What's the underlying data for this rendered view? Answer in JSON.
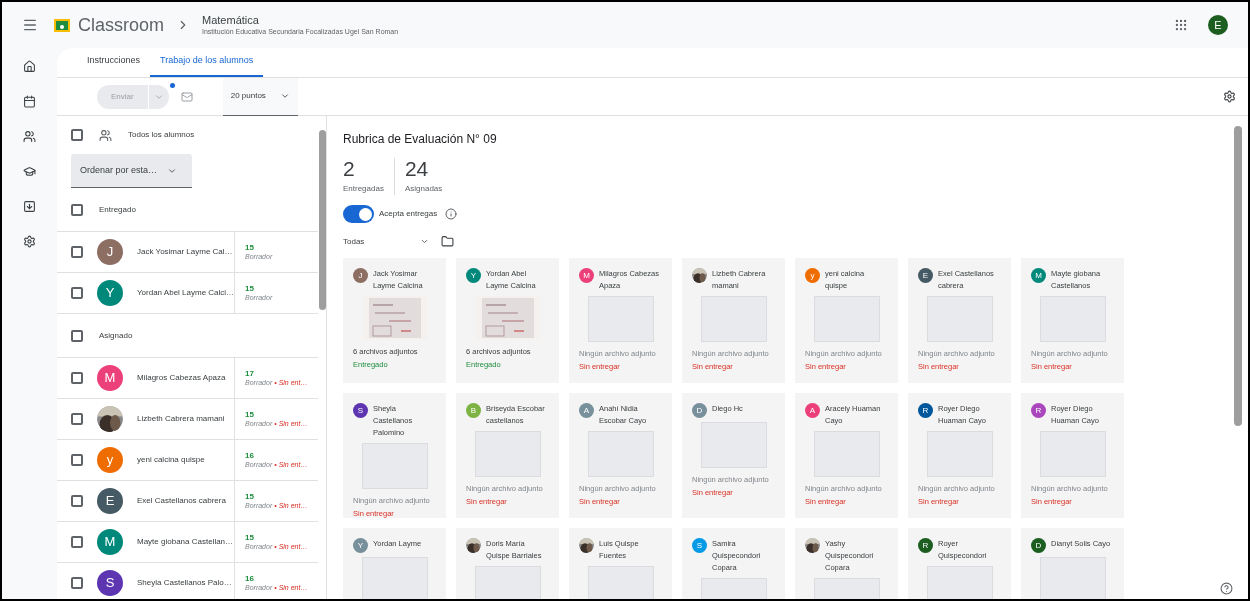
{
  "header": {
    "app_name": "Classroom",
    "class_title": "Matemática",
    "class_subtitle": "Institución Educativa Secundaria Focalizadas Ugel San Roman",
    "account_letter": "E"
  },
  "tabs": [
    {
      "label": "Instrucciones",
      "selected": false
    },
    {
      "label": "Trabajo de los alumnos",
      "selected": true
    }
  ],
  "toolbar": {
    "return_button": "Enviar",
    "points": "20 puntos"
  },
  "student_list": {
    "all_students": {
      "label": "Todos los alumnos",
      "checked": false
    },
    "sort": "Ordenar por esta…",
    "sections": [
      {
        "title": "Entregado",
        "checked": false,
        "students": [
          {
            "name": "Jack Yosimar Layme Cal…",
            "avatar": {
              "kind": "letter",
              "letter": "J",
              "color": "#8d6e63"
            },
            "grade": "15",
            "draft": "Borrador",
            "checked": false
          },
          {
            "name": "Yordan Abel Layme Calci…",
            "avatar": {
              "kind": "letter",
              "letter": "Y",
              "color": "#00897b"
            },
            "grade": "15",
            "draft": "Borrador",
            "checked": false
          }
        ]
      },
      {
        "title": "Asignado",
        "checked": false,
        "students": [
          {
            "name": "Milagros Cabezas Apaza",
            "avatar": {
              "kind": "letter",
              "letter": "M",
              "color": "#ec407a"
            },
            "grade": "17",
            "draft": "Borrador",
            "missing": "• Sin ent…",
            "checked": false
          },
          {
            "name": "Lizbeth Cabrera mamani",
            "grade": "15",
            "draft": "Borrador",
            "missing": "• Sin ent…",
            "checked": false
          },
          {
            "name": "yeni calcina quispe",
            "avatar": {
              "kind": "letter",
              "letter": "y",
              "color": "#ef6c00"
            },
            "grade": "16",
            "draft": "Borrador",
            "missing": "• Sin ent…",
            "checked": false
          },
          {
            "name": "Exel Castellanos cabrera",
            "avatar": {
              "kind": "letter",
              "letter": "E",
              "color": "#455a64"
            },
            "grade": "15",
            "draft": "Borrador",
            "missing": "• Sin ent…",
            "checked": false
          },
          {
            "name": "Mayte giobana Castellan…",
            "avatar": {
              "kind": "letter",
              "letter": "M",
              "color": "#00897b"
            },
            "grade": "15",
            "draft": "Borrador",
            "missing": "• Sin ent…",
            "checked": false
          },
          {
            "name": "Sheyla Castellanos Palo…",
            "avatar": {
              "kind": "letter",
              "letter": "S",
              "color": "#5e35b1"
            },
            "grade": "16",
            "draft": "Borrador",
            "missing": "• Sin ent…",
            "checked": false
          }
        ]
      }
    ]
  },
  "assignment": {
    "title": "Rubrica de Evaluación N° 09",
    "stats": [
      {
        "value": "2",
        "label": "Entregadas"
      },
      {
        "value": "24",
        "label": "Asignadas"
      }
    ],
    "accepting": {
      "label": "Acepta entregas",
      "on": true
    },
    "filter": "Todas",
    "cards": [
      {
        "name": "Jack Yosimar Layme Calcina",
        "avatar": {
          "kind": "letter",
          "letter": "J",
          "color": "#8d6e63"
        },
        "attachments": "6 archivos adjuntos",
        "status": {
          "text": "Entregado",
          "kind": "turned_in"
        }
      },
      {
        "name": "Yordan Abel Layme Calcina",
        "avatar": {
          "kind": "letter",
          "letter": "Y",
          "color": "#00897b"
        },
        "attachments": "6 archivos adjuntos",
        "status": {
          "text": "Entregado",
          "kind": "turned_in"
        }
      },
      {
        "name": "Milagros Cabezas Apaza",
        "avatar": {
          "kind": "letter",
          "letter": "M",
          "color": "#ec407a"
        },
        "thumbnail": {
          "kind": "empty"
        },
        "attachments": "Ningún archivo adjunto",
        "status": {
          "text": "Sin entregar",
          "kind": "missing"
        }
      },
      {
        "name": "Lizbeth Cabrera mamani",
        "thumbnail": {
          "kind": "empty"
        },
        "attachments": "Ningún archivo adjunto",
        "status": {
          "text": "Sin entregar",
          "kind": "missing"
        }
      },
      {
        "name": "yeni calcina quispe",
        "avatar": {
          "kind": "letter",
          "letter": "y",
          "color": "#ef6c00"
        },
        "thumbnail": {
          "kind": "empty"
        },
        "attachments": "Ningún archivo adjunto",
        "status": {
          "text": "Sin entregar",
          "kind": "missing"
        }
      },
      {
        "name": "Exel Castellanos cabrera",
        "avatar": {
          "kind": "letter",
          "letter": "E",
          "color": "#455a64"
        },
        "thumbnail": {
          "kind": "empty"
        },
        "attachments": "Ningún archivo adjunto",
        "status": {
          "text": "Sin entregar",
          "kind": "missing"
        }
      },
      {
        "name": "Mayte giobana Castellanos",
        "avatar": {
          "kind": "letter",
          "letter": "M",
          "color": "#00897b"
        },
        "thumbnail": {
          "kind": "empty"
        },
        "attachments": "Ningún archivo adjunto",
        "status": {
          "text": "Sin entregar",
          "kind": "missing"
        }
      },
      {
        "name": "Sheyla Castellanos Palomino",
        "avatar": {
          "kind": "letter",
          "letter": "S",
          "color": "#5e35b1"
        },
        "thumbnail": {
          "kind": "empty"
        },
        "attachments": "Ningún archivo adjunto",
        "status": {
          "text": "Sin entregar",
          "kind": "missing"
        }
      },
      {
        "name": "Briseyda Escobar castellanos",
        "avatar": {
          "kind": "letter",
          "letter": "B",
          "color": "#7cb342"
        },
        "thumbnail": {
          "kind": "empty"
        },
        "attachments": "Ningún archivo adjunto",
        "status": {
          "text": "Sin entregar",
          "kind": "missing"
        }
      },
      {
        "name": "Anahí Nidia Escobar Cayo",
        "avatar": {
          "kind": "letter",
          "letter": "A",
          "color": "#78909c"
        },
        "thumbnail": {
          "kind": "empty"
        },
        "attachments": "Ningún archivo adjunto",
        "status": {
          "text": "Sin entregar",
          "kind": "missing"
        }
      },
      {
        "name": "Diego Hc",
        "avatar": {
          "kind": "letter",
          "letter": "D",
          "color": "#78909c"
        },
        "thumbnail": {
          "kind": "empty"
        },
        "attachments": "Ningún archivo adjunto",
        "status": {
          "text": "Sin entregar",
          "kind": "missing"
        }
      },
      {
        "name": "Aracely Huaman Cayo",
        "avatar": {
          "kind": "letter",
          "letter": "A",
          "color": "#ec407a"
        },
        "thumbnail": {
          "kind": "empty"
        },
        "attachments": "Ningún archivo adjunto",
        "status": {
          "text": "Sin entregar",
          "kind": "missing"
        }
      },
      {
        "name": "Royer Diego Huaman Cayo",
        "avatar": {
          "kind": "letter",
          "letter": "R",
          "color": "#01579b"
        },
        "thumbnail": {
          "kind": "empty"
        },
        "attachments": "Ningún archivo adjunto",
        "status": {
          "text": "Sin entregar",
          "kind": "missing"
        }
      },
      {
        "name": "Royer Diego Huaman Cayo",
        "avatar": {
          "kind": "letter",
          "letter": "R",
          "color": "#ab47bc"
        },
        "thumbnail": {
          "kind": "empty"
        },
        "attachments": "Ningún archivo adjunto",
        "status": {
          "text": "Sin entregar",
          "kind": "missing"
        }
      },
      {
        "name": "Yordan Layme",
        "avatar": {
          "kind": "letter",
          "letter": "Y",
          "color": "#78909c"
        },
        "thumbnail": {
          "kind": "empty"
        }
      },
      {
        "name": "Doris María Quispe Barriales",
        "thumbnail": {
          "kind": "empty"
        }
      },
      {
        "name": "Luis Quispe Fuentes",
        "thumbnail": {
          "kind": "empty"
        }
      },
      {
        "name": "Samira Quispecondori Copara",
        "avatar": {
          "kind": "letter",
          "letter": "S",
          "color": "#039be5"
        },
        "thumbnail": {
          "kind": "empty"
        }
      },
      {
        "name": "Yashy Quispecondori Copara",
        "thumbnail": {
          "kind": "empty"
        }
      },
      {
        "name": "Royer Quispecondori",
        "avatar": {
          "kind": "letter",
          "letter": "R",
          "color": "#1b5e20"
        },
        "thumbnail": {
          "kind": "empty"
        }
      },
      {
        "name": "Dianyt Solis Cayo",
        "avatar": {
          "kind": "letter",
          "letter": "D",
          "color": "#1b5e20"
        },
        "thumbnail": {
          "kind": "empty"
        }
      }
    ]
  }
}
